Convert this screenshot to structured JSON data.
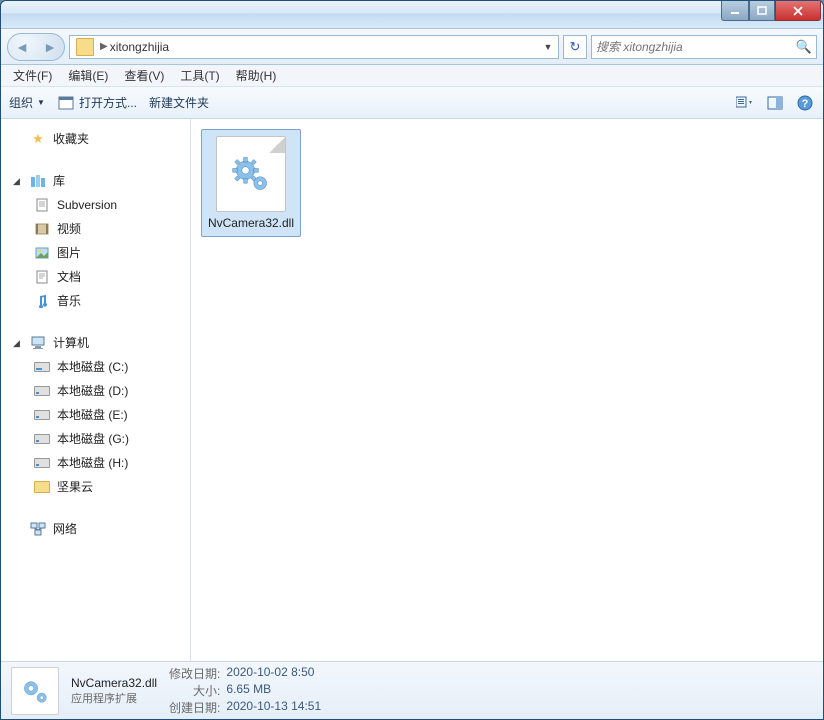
{
  "address": {
    "path": "xitongzhijia"
  },
  "search": {
    "placeholder": "搜索 xitongzhijia"
  },
  "menu": {
    "file": "文件(F)",
    "edit": "编辑(E)",
    "view": "查看(V)",
    "tools": "工具(T)",
    "help": "帮助(H)"
  },
  "toolbar": {
    "organize": "组织",
    "open_with": "打开方式...",
    "new_folder": "新建文件夹"
  },
  "sidebar": {
    "favorites": "收藏夹",
    "libraries": "库",
    "lib_items": {
      "subversion": "Subversion",
      "video": "视频",
      "pictures": "图片",
      "documents": "文档",
      "music": "音乐"
    },
    "computer": "计算机",
    "drives": {
      "c": "本地磁盘 (C:)",
      "d": "本地磁盘 (D:)",
      "e": "本地磁盘 (E:)",
      "g": "本地磁盘 (G:)",
      "h": "本地磁盘 (H:)",
      "jianguo": "坚果云"
    },
    "network": "网络"
  },
  "file": {
    "name": "NvCamera32.dll"
  },
  "details": {
    "name": "NvCamera32.dll",
    "type": "应用程序扩展",
    "modified_label": "修改日期:",
    "modified": "2020-10-02 8:50",
    "size_label": "大小:",
    "size": "6.65 MB",
    "created_label": "创建日期:",
    "created": "2020-10-13 14:51"
  }
}
